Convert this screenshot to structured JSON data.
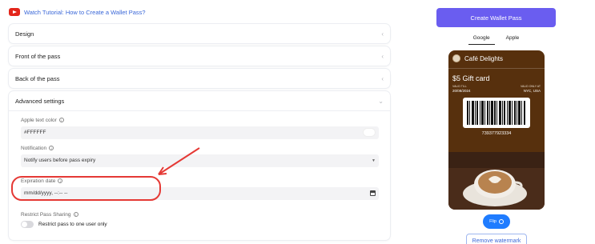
{
  "tutorial": {
    "label": "Watch Tutorial: How to Create a Wallet Pass?"
  },
  "accordion": {
    "design": "Design",
    "front": "Front of the pass",
    "back": "Back of the pass",
    "advanced": "Advanced settings"
  },
  "advanced": {
    "apple_text_color_label": "Apple text color",
    "apple_text_color_value": "#FFFFFF",
    "notification_label": "Notification",
    "notification_value": "Notify users before pass expiry",
    "expiration_label": "Expiration date",
    "expiration_value": "mm/dd/yyyy, --:-- --",
    "restrict_label": "Restrict Pass Sharing",
    "restrict_toggle_label": "Restrict pass to one user only",
    "restrict_enabled": false
  },
  "preview": {
    "create_button": "Create Wallet Pass",
    "tabs": [
      "Google",
      "Apple"
    ],
    "active_tab": "Google",
    "card": {
      "title": "Café Delights",
      "amount": "$5 Gift card",
      "valid_till_label": "VALID TILL",
      "valid_till": "20/08/2024",
      "valid_only_at_label": "VALID ONLY AT",
      "valid_only_at": "NYC, USA",
      "barcode_number": "739377923334",
      "background_color": "#57300d"
    },
    "flip_button": "Flip",
    "remove_watermark": "Remove watermark"
  },
  "colors": {
    "accent": "#6a5df0",
    "link": "#3a67d8",
    "flip": "#1f7cff",
    "annotation": "#e53935"
  },
  "icons": {
    "tutorial": "youtube-icon",
    "collapsed": "chevron-left-icon",
    "expanded": "chevron-down-icon",
    "info": "info-icon",
    "calendar": "calendar-icon",
    "flip": "flip-icon"
  }
}
